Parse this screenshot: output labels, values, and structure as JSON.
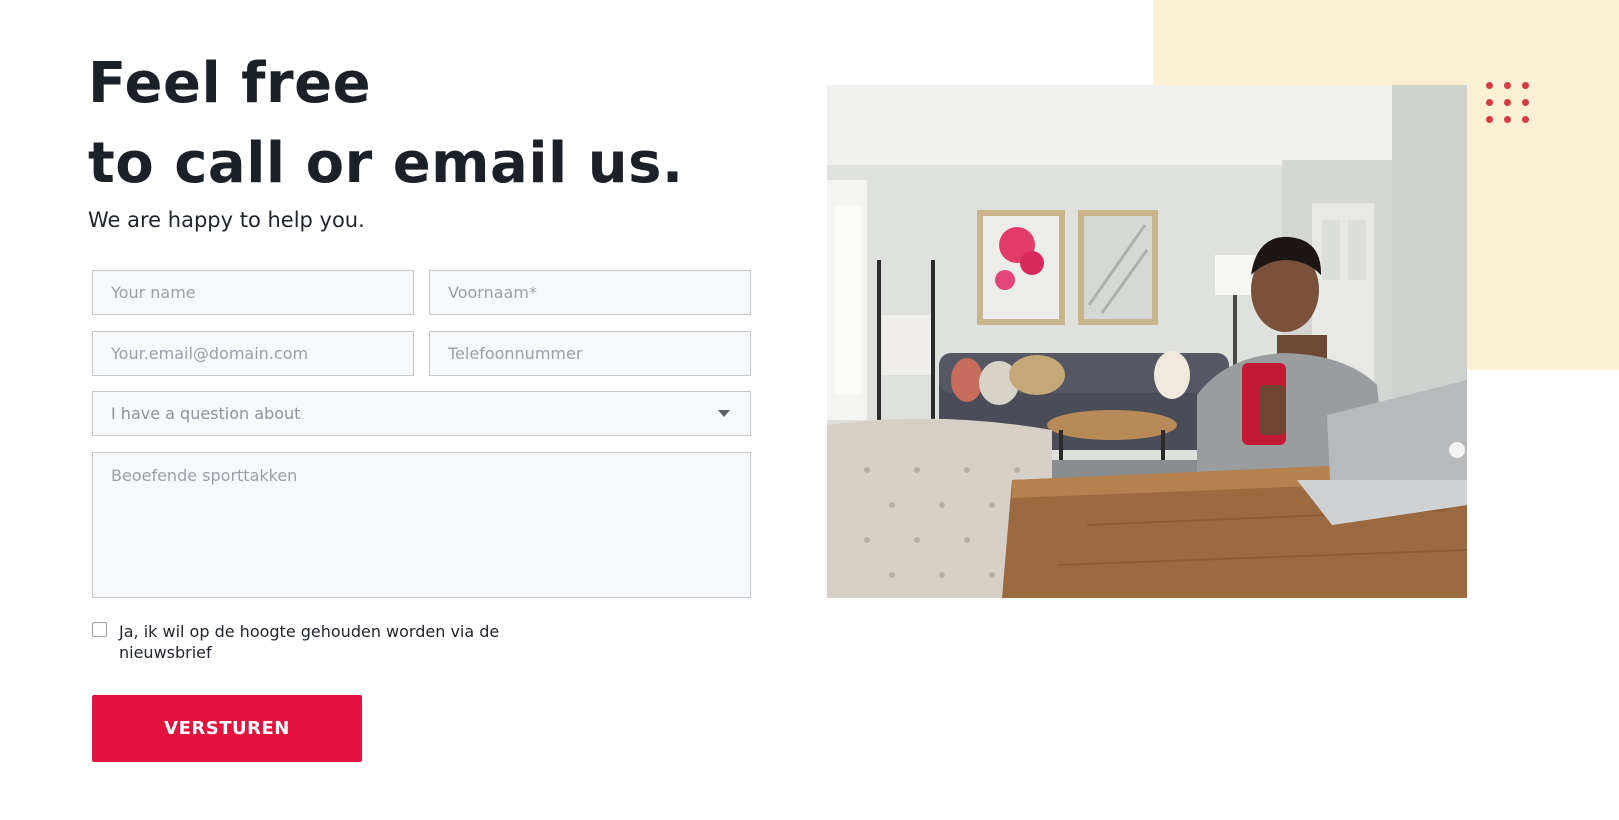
{
  "hero": {
    "headline_line1": "Feel free",
    "headline_line2": "to call or email us.",
    "subtitle": "We are happy to help you."
  },
  "form": {
    "name_placeholder": "Your name",
    "firstname_placeholder": "Voornaam*",
    "email_placeholder": "Your.email@domain.com",
    "phone_placeholder": "Telefoonnummer",
    "topic_select": "I have a question about",
    "message_placeholder": "Beoefende sporttakken",
    "newsletter_label": "Ja, ik wil op de hoogte gehouden worden via de nieuwsbrief",
    "newsletter_checked": false,
    "submit_label": "VERSTUREN"
  },
  "colors": {
    "accent": "#e4123e",
    "decor_block": "#fcf0d4",
    "dots": "#d63a43"
  },
  "icons": {
    "select_caret": "chevron-down-icon",
    "decor_dots": "dot-grid-icon"
  }
}
